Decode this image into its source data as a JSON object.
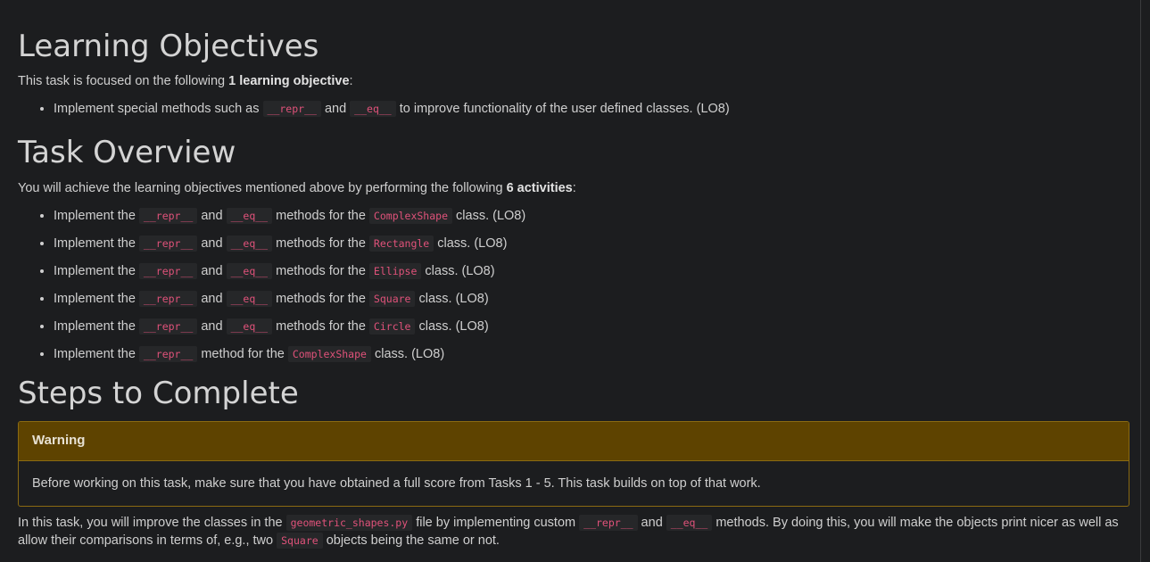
{
  "learning_objectives": {
    "heading": "Learning Objectives",
    "intro_prefix": "This task is focused on the following ",
    "intro_bold": "1 learning objective",
    "intro_suffix": ":",
    "items": [
      {
        "t1": "Implement special methods such as ",
        "c1": "__repr__",
        "t2": " and ",
        "c2": "__eq__",
        "t3": " to improve functionality of the user defined classes. (LO8)"
      }
    ]
  },
  "task_overview": {
    "heading": "Task Overview",
    "intro_prefix": "You will achieve the learning objectives mentioned above by performing the following ",
    "intro_bold": "6 activities",
    "intro_suffix": ":",
    "items": [
      {
        "t1": "Implement the ",
        "c1": "__repr__",
        "t2": " and ",
        "c2": "__eq__",
        "t3": " methods for the ",
        "c3": "ComplexShape",
        "t4": " class. (LO8)"
      },
      {
        "t1": "Implement the ",
        "c1": "__repr__",
        "t2": " and ",
        "c2": "__eq__",
        "t3": " methods for the ",
        "c3": "Rectangle",
        "t4": " class. (LO8)"
      },
      {
        "t1": "Implement the ",
        "c1": "__repr__",
        "t2": " and ",
        "c2": "__eq__",
        "t3": " methods for the ",
        "c3": "Ellipse",
        "t4": " class. (LO8)"
      },
      {
        "t1": "Implement the ",
        "c1": "__repr__",
        "t2": " and ",
        "c2": "__eq__",
        "t3": " methods for the ",
        "c3": "Square",
        "t4": " class. (LO8)"
      },
      {
        "t1": "Implement the ",
        "c1": "__repr__",
        "t2": " and ",
        "c2": "__eq__",
        "t3": " methods for the ",
        "c3": "Circle",
        "t4": " class. (LO8)"
      },
      {
        "t1": "Implement the ",
        "c1": "__repr__",
        "t2": " method for the ",
        "c2": "ComplexShape",
        "t3": " class. (LO8)"
      }
    ]
  },
  "steps": {
    "heading": "Steps to Complete",
    "warning": {
      "title": "Warning",
      "body": "Before working on this task, make sure that you have obtained a full score from Tasks 1 - 5. This task builds on top of that work."
    },
    "paragraph": {
      "t1": "In this task, you will improve the classes in the ",
      "c1": "geometric_shapes.py",
      "t2": " file by implementing custom ",
      "c2": "__repr__",
      "t3": " and ",
      "c3": "__eq__",
      "t4": " methods. By doing this, you will make the objects print nicer as well as allow their comparisons in terms of, e.g., two ",
      "c4": "Square",
      "t5": " objects being the same or not."
    }
  }
}
